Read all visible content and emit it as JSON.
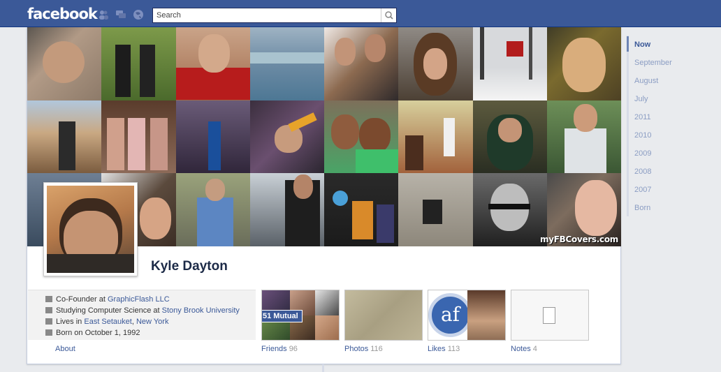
{
  "header": {
    "logo": "facebook",
    "search_placeholder": "Search"
  },
  "profile": {
    "name": "Kyle Dayton",
    "cover_watermark": "myFBCovers.com"
  },
  "info": {
    "work_prefix": "Co-Founder at ",
    "work_link": "GraphicFlash LLC",
    "study_prefix": "Studying Computer Science at ",
    "study_link": "Stony Brook University",
    "lives_prefix": "Lives in ",
    "lives_link_1": "East Setauket",
    "lives_sep": ", ",
    "lives_link_2": "New York",
    "born": "Born on October 1, 1992",
    "about": "About"
  },
  "boxes": {
    "friends": {
      "label": "Friends",
      "count": "96",
      "badge": "51 Mutual"
    },
    "photos": {
      "label": "Photos",
      "count": "116"
    },
    "likes": {
      "label": "Likes",
      "count": "113",
      "logo": "af"
    },
    "notes": {
      "label": "Notes",
      "count": "4"
    }
  },
  "timeline": [
    "Now",
    "September",
    "August",
    "July",
    "2011",
    "2010",
    "2009",
    "2008",
    "2007",
    "Born"
  ],
  "colors": {
    "brand": "#3b5998",
    "link": "#3b5998",
    "timeline_inactive": "#8b9dc3"
  }
}
